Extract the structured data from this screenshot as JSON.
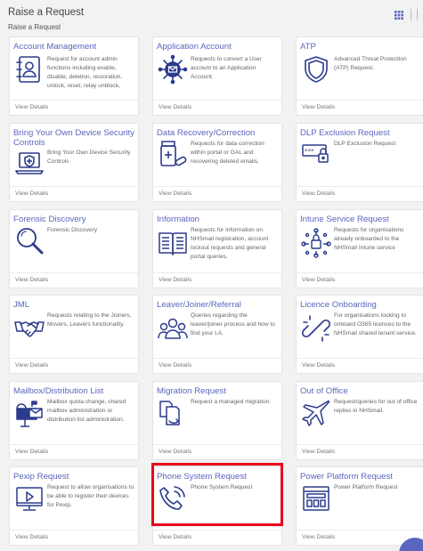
{
  "header": {
    "title": "Raise a Request",
    "breadcrumb": "Raise a Request"
  },
  "icons": {
    "layout_toggle": "grid-icon"
  },
  "colors": {
    "accent": "#5a66bd",
    "icon_navy": "#2b3a8c",
    "highlight": "#e8001c"
  },
  "cards": [
    {
      "title": "Account Management",
      "description": "Request for account admin functions including enable, disable, deletion, restoration, unlock, reset, relay unblock,",
      "footer": "View Details",
      "icon": "address-book-icon"
    },
    {
      "title": "Application Account",
      "description": "Requests to convert a User account to an Application Account.",
      "footer": "View Details",
      "icon": "mail-network-icon"
    },
    {
      "title": "ATP",
      "description": "Advanced Threat Protection (ATP) Request.",
      "footer": "View Details",
      "icon": "shield-icon"
    },
    {
      "title": "Bring Your Own Device Security Controls",
      "description": "Bring Your Own Device Security Controls",
      "footer": "View Details",
      "icon": "laptop-shield-icon"
    },
    {
      "title": "Data Recovery/Correction",
      "description": "Requests for data correction within portal or GAL and recovering deleted emails.",
      "footer": "View Details",
      "icon": "medicine-bottle-icon"
    },
    {
      "title": "DLP Exclusion Request",
      "description": "DLP Exclusion Request",
      "footer": "View Details",
      "icon": "password-lock-icon"
    },
    {
      "title": "Forensic Discovery",
      "description": "Forensic Discovery",
      "footer": "View Details",
      "icon": "magnifier-icon"
    },
    {
      "title": "Information",
      "description": "Requests for information on NHSmail registration, account lockout requests and general portal queries.",
      "footer": "View Details",
      "icon": "open-book-icon"
    },
    {
      "title": "Intune Service Request",
      "description": "Requests for organisations already onboarded to the NHSmail Intune service",
      "footer": "View Details",
      "icon": "network-lock-icon"
    },
    {
      "title": "JML",
      "description": "Requests relating to the Joiners, Movers, Leavers functionality.",
      "footer": "View Details",
      "icon": "handshake-icon"
    },
    {
      "title": "Leaver/Joiner/Referral",
      "description": "Queries regarding the leaver/joiner process and how to find your LA.",
      "footer": "View Details",
      "icon": "people-group-icon"
    },
    {
      "title": "Licence Onboarding",
      "description": "For organisations looking to onboard O365 licences to the NHSmail shared tenant service.",
      "footer": "View Details",
      "icon": "link-icon"
    },
    {
      "title": "Mailbox/Distribution List",
      "description": "Mailbox quota change, shared mailbox administration or distribution list administration.",
      "footer": "View Details",
      "icon": "mailbox-icon"
    },
    {
      "title": "Migration Request",
      "description": "Request a managed migration.",
      "footer": "View Details",
      "icon": "file-migration-icon"
    },
    {
      "title": "Out of Office",
      "description": "Request/queries for out of office replies in NHSmail.",
      "footer": "View Details",
      "icon": "airplane-icon"
    },
    {
      "title": "Pexip Request",
      "description": "Request to allow organisations to be able to register their devices for Pexip.",
      "footer": "View Details",
      "icon": "video-monitor-icon"
    },
    {
      "title": "Phone System Request",
      "description": "Phone System Request",
      "footer": "View Details",
      "icon": "phone-ringing-icon"
    },
    {
      "title": "Power Platform Request",
      "description": "Power Platform Request",
      "footer": "View Details",
      "icon": "app-window-icon"
    }
  ]
}
